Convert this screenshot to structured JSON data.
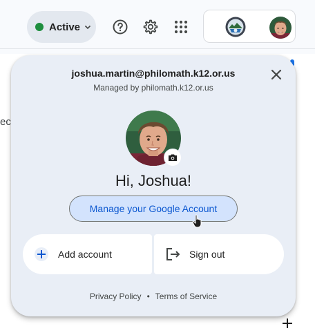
{
  "header": {
    "status_label": "Active",
    "status_color": "#1e8e3e",
    "icons": [
      "help-icon",
      "gear-icon",
      "apps-grid-icon"
    ]
  },
  "background": {
    "partial_text": "ec"
  },
  "account_panel": {
    "email": "joshua.martin@philomath.k12.or.us",
    "managed_by": "Managed by philomath.k12.or.us",
    "greeting": "Hi, Joshua!",
    "manage_button": "Manage your Google Account",
    "add_account": "Add account",
    "sign_out": "Sign out",
    "footer": {
      "privacy": "Privacy Policy",
      "separator": "•",
      "terms": "Terms of Service"
    }
  },
  "colors": {
    "accent": "#0b57d0",
    "panel_bg": "#e9eef6",
    "manage_bg": "#d3e3fd"
  }
}
